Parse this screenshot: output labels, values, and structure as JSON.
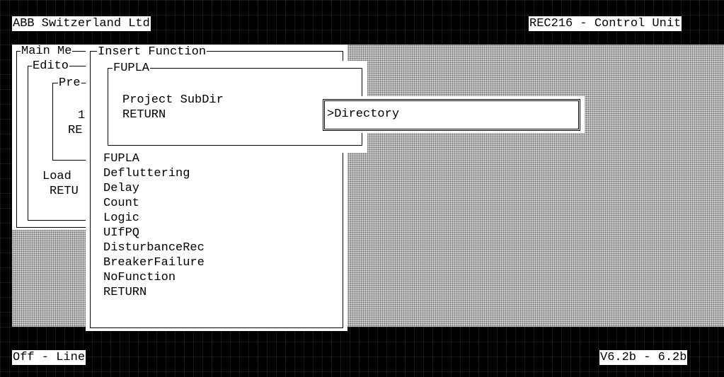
{
  "header": {
    "company": "ABB Switzerland Ltd",
    "unit": "REC216 - Control Unit"
  },
  "footer": {
    "status": "Off - Line",
    "version": "V6.2b - 6.2b"
  },
  "main_menu": {
    "title": "Main Me",
    "items": [
      "Load",
      "RETU"
    ]
  },
  "editor_menu": {
    "title": "Edito"
  },
  "pre_menu": {
    "title": "Pre",
    "items": [
      "1",
      "RE"
    ]
  },
  "insert_function": {
    "title": "Insert Function",
    "items": [
      "FUPLA",
      "Defluttering",
      "Delay",
      "Count",
      "Logic",
      "UIfPQ",
      "DisturbanceRec",
      "BreakerFailure",
      "NoFunction",
      "RETURN"
    ]
  },
  "fupla_menu": {
    "title": "FUPLA",
    "items": [
      "Project SubDir",
      "RETURN"
    ]
  },
  "directory_input": {
    "value": ">Directory"
  },
  "colors": {
    "background": "#000000",
    "window": "#ffffff",
    "desktop_pattern": "#c9c9c9"
  }
}
